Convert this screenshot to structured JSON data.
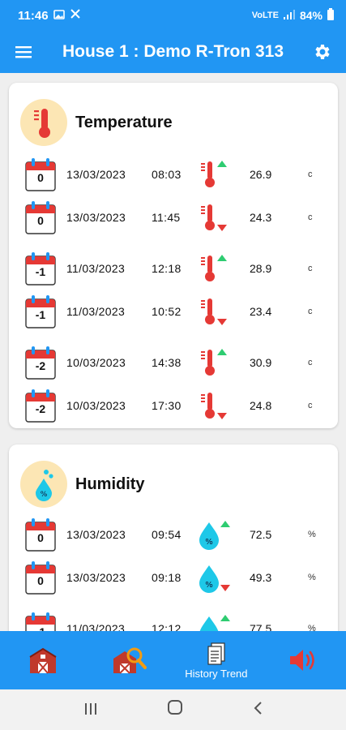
{
  "status_bar": {
    "time": "11:46",
    "battery": "84%",
    "network": "VoLTE"
  },
  "app_bar": {
    "title": "House 1 : Demo R-Tron 313"
  },
  "temperature": {
    "title": "Temperature",
    "rows": [
      {
        "day": "0",
        "date": "13/03/2023",
        "time": "08:03",
        "trend": "up",
        "value": "26.9",
        "unit": "c"
      },
      {
        "day": "0",
        "date": "13/03/2023",
        "time": "11:45",
        "trend": "down",
        "value": "24.3",
        "unit": "c"
      },
      {
        "day": "-1",
        "date": "11/03/2023",
        "time": "12:18",
        "trend": "up",
        "value": "28.9",
        "unit": "c"
      },
      {
        "day": "-1",
        "date": "11/03/2023",
        "time": "10:52",
        "trend": "down",
        "value": "23.4",
        "unit": "c"
      },
      {
        "day": "-2",
        "date": "10/03/2023",
        "time": "14:38",
        "trend": "up",
        "value": "30.9",
        "unit": "c"
      },
      {
        "day": "-2",
        "date": "10/03/2023",
        "time": "17:30",
        "trend": "down",
        "value": "24.8",
        "unit": "c"
      }
    ]
  },
  "humidity": {
    "title": "Humidity",
    "rows": [
      {
        "day": "0",
        "date": "13/03/2023",
        "time": "09:54",
        "trend": "up",
        "value": "72.5",
        "unit": "%"
      },
      {
        "day": "0",
        "date": "13/03/2023",
        "time": "09:18",
        "trend": "down",
        "value": "49.3",
        "unit": "%"
      },
      {
        "day": "-1",
        "date": "11/03/2023",
        "time": "12:12",
        "trend": "up",
        "value": "77.5",
        "unit": "%"
      }
    ]
  },
  "bottom_nav": {
    "items": [
      {
        "icon": "barn-icon",
        "label": ""
      },
      {
        "icon": "barn-search-icon",
        "label": ""
      },
      {
        "icon": "document-stack-icon",
        "label": "History Trend"
      },
      {
        "icon": "speaker-alarm-icon",
        "label": ""
      }
    ]
  },
  "colors": {
    "primary": "#2196F3",
    "red": "#E53935",
    "green": "#2ECC71",
    "water": "#1EC8E8",
    "temp_bubble": "#FCE6B4"
  }
}
